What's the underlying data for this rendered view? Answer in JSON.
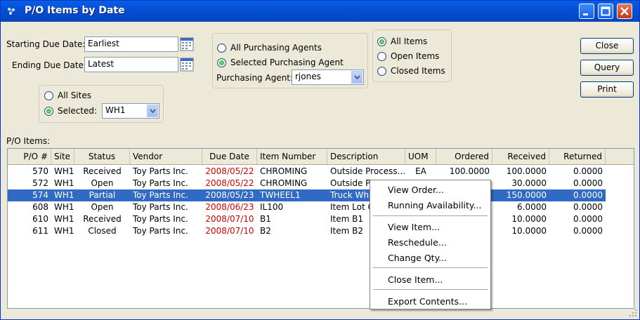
{
  "window": {
    "title": "P/O Items by Date"
  },
  "filters": {
    "starting_due_date_label": "Starting Due Date:",
    "starting_due_date_value": "Earliest",
    "ending_due_date_label": "Ending Due Date:",
    "ending_due_date_value": "Latest",
    "sites": {
      "all_label": "All Sites",
      "selected_label": "Selected:",
      "selected_value": "WH1",
      "selected": "selected"
    },
    "agents": {
      "all_label": "All Purchasing Agents",
      "selected_label": "Selected Purchasing Agent",
      "agent_label": "Purchasing Agent:",
      "agent_value": "rjones",
      "selected": "selected"
    },
    "items": {
      "all_label": "All Items",
      "open_label": "Open Items",
      "closed_label": "Closed Items",
      "selected": "all"
    }
  },
  "buttons": {
    "close": "Close",
    "query": "Query",
    "print": "Print"
  },
  "table": {
    "label": "P/O Items:",
    "columns": [
      "P/O #",
      "Site",
      "Status",
      "Vendor",
      "Due Date",
      "Item Number",
      "Description",
      "UOM",
      "Ordered",
      "Received",
      "Returned"
    ],
    "rows": [
      {
        "po": "570",
        "site": "WH1",
        "status": "Received",
        "vendor": "Toy Parts Inc.",
        "due": "2008/05/22",
        "item": "CHROMING",
        "desc": "Outside Process...",
        "uom": "EA",
        "ordered": "100.0000",
        "received": "100.0000",
        "returned": "0.0000"
      },
      {
        "po": "572",
        "site": "WH1",
        "status": "Open",
        "vendor": "Toy Parts Inc.",
        "due": "2008/05/22",
        "item": "CHROMING",
        "desc": "Outside Pr",
        "uom": "",
        "ordered": "",
        "received": "30.0000",
        "returned": "0.0000"
      },
      {
        "po": "574",
        "site": "WH1",
        "status": "Partial",
        "vendor": "Toy Parts Inc.",
        "due": "2008/05/23",
        "item": "TWHEEL1",
        "desc": "Truck Whe",
        "uom": "",
        "ordered": "",
        "received": "150.0000",
        "returned": "0.0000"
      },
      {
        "po": "608",
        "site": "WH1",
        "status": "Open",
        "vendor": "Toy Parts Inc.",
        "due": "2008/06/23",
        "item": "IL100",
        "desc": "Item Lot C",
        "uom": "",
        "ordered": "",
        "received": "6.0000",
        "returned": "0.0000"
      },
      {
        "po": "610",
        "site": "WH1",
        "status": "Received",
        "vendor": "Toy Parts Inc.",
        "due": "2008/07/10",
        "item": "B1",
        "desc": "Item B1",
        "uom": "",
        "ordered": "",
        "received": "10.0000",
        "returned": "0.0000"
      },
      {
        "po": "611",
        "site": "WH1",
        "status": "Closed",
        "vendor": "Toy Parts Inc.",
        "due": "2008/07/10",
        "item": "B2",
        "desc": "Item B2",
        "uom": "",
        "ordered": "",
        "received": "10.0000",
        "returned": "0.0000"
      }
    ],
    "selected_row": 2
  },
  "context_menu": {
    "items": [
      "View Order...",
      "Running Availability...",
      "View Item...",
      "Reschedule...",
      "Change Qty...",
      "Close Item...",
      "Export Contents..."
    ]
  },
  "colors": {
    "title_bar": "#0450d8",
    "selection": "#316ac5",
    "late_date": "#d40000"
  }
}
